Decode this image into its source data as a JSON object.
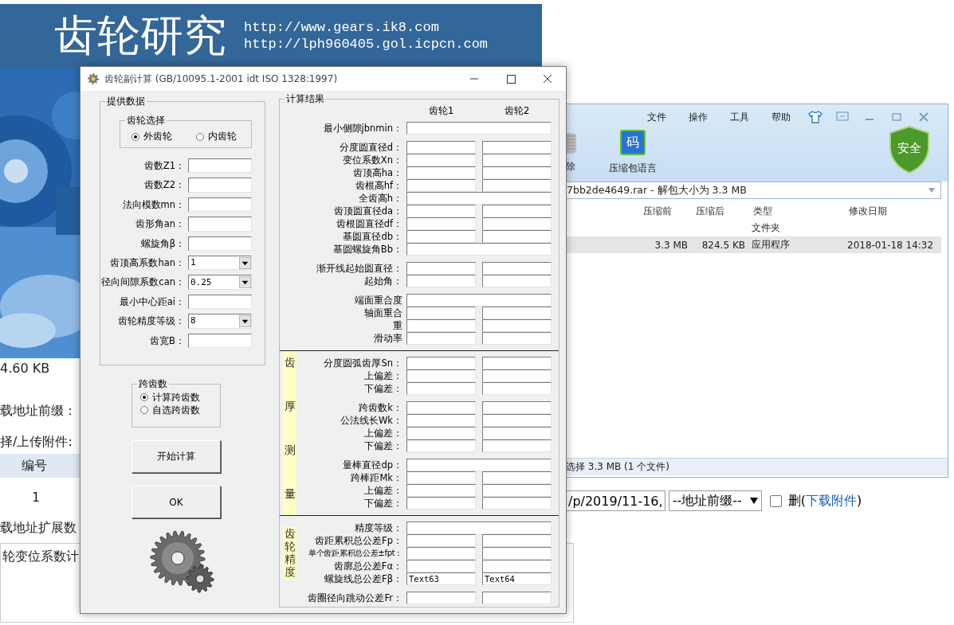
{
  "browser_page": {
    "banner": {
      "title": "齿轮研究",
      "urls": [
        "http://www.gears.ik8.com",
        "http://lph960405.gol.icpcn.com"
      ]
    },
    "file_size": "4.60 KB",
    "labels": [
      "载地址前缀：",
      "择/上传附件:"
    ],
    "table": {
      "header": "编号",
      "cell": "1"
    },
    "label_extra": "载地址扩展数",
    "box_text": "轮变位系数计",
    "path_field": {
      "value": "/p/2019/11-16,"
    },
    "prefix_select": {
      "value": "--地址前缀--"
    },
    "delete_option": {
      "checked": false,
      "before": "删(",
      "link": "下载附件",
      "after": ")"
    }
  },
  "archiver": {
    "menu": [
      "文件",
      "操作",
      "工具",
      "帮助"
    ],
    "tools": [
      {
        "kind": "trash",
        "label": "除"
      },
      {
        "kind": "code",
        "label": "压缩包语言",
        "icon_text": "码"
      }
    ],
    "badge": "安全",
    "path": "7bb2de4649.rar - 解包大小为 3.3 MB",
    "columns": [
      "压缩前",
      "压缩后",
      "类型",
      "修改日期"
    ],
    "rows": [
      {
        "type": "文件夹",
        "selected": false
      },
      {
        "before": "3.3 MB",
        "after": "824.5 KB",
        "type": "应用程序",
        "date": "2018-01-18 14:32",
        "selected": true
      }
    ],
    "status": "选择 3.3 MB (1 个文件)"
  },
  "dialog": {
    "title": "齿轮副计算 (GB/10095.1-2001 idt ISO 1328:1997)",
    "input_group": {
      "title": "提供数据",
      "gear_type": {
        "title": "齿轮选择",
        "options": [
          {
            "label": "外齿轮",
            "selected": true
          },
          {
            "label": "内齿轮",
            "selected": false
          }
        ]
      },
      "fields": [
        {
          "label": "齿数Z1：",
          "kind": "text"
        },
        {
          "label": "齿数Z2：",
          "kind": "text"
        },
        {
          "label": "法向模数mn：",
          "kind": "text"
        },
        {
          "label": "齿形角an：",
          "kind": "text"
        },
        {
          "label": "螺旋角β：",
          "kind": "text"
        },
        {
          "label": "齿顶高系数han：",
          "kind": "select",
          "value": "1"
        },
        {
          "label": "径向间隙系数can：",
          "kind": "select",
          "value": "0.25"
        },
        {
          "label": "最小中心距ai：",
          "kind": "text"
        },
        {
          "label": "齿轮精度等级：",
          "kind": "select",
          "value": "8"
        },
        {
          "label": "齿宽B：",
          "kind": "text"
        }
      ]
    },
    "span_group": {
      "title": "跨齿数",
      "options": [
        {
          "label": "计算跨齿数",
          "selected": true
        },
        {
          "label": "自选跨齿数",
          "selected": false
        }
      ]
    },
    "buttons": [
      "开始计算",
      "OK"
    ],
    "results": {
      "title": "计算结果",
      "headers": [
        "齿轮1",
        "齿轮2"
      ],
      "sections": [
        {
          "kind": "plain",
          "groups": [
            [
              {
                "label": "最小侧隙jbnmin：",
                "kind": "single"
              }
            ],
            [
              {
                "label": "分度圆直径d：",
                "kind": "pair"
              },
              {
                "label": "变位系数Xn：",
                "kind": "pair"
              },
              {
                "label": "齿顶高ha：",
                "kind": "pair"
              },
              {
                "label": "齿根高hf：",
                "kind": "pair"
              },
              {
                "label": "全齿高h：",
                "kind": "single"
              },
              {
                "label": "齿顶圆直径da：",
                "kind": "pair"
              },
              {
                "label": "齿根圆直径df：",
                "kind": "pair"
              },
              {
                "label": "基圆直径db：",
                "kind": "pair"
              },
              {
                "label": "基圆螺旋角Bb：",
                "kind": "single"
              }
            ],
            [
              {
                "label": "渐开线起始圆直径：",
                "kind": "pair"
              },
              {
                "label": "起始角：",
                "kind": "pair"
              }
            ],
            [
              {
                "label": "端面重合度",
                "kind": "single"
              },
              {
                "label": "轴面重合",
                "kind": "pair"
              },
              {
                "label": "重",
                "kind": "pair"
              },
              {
                "label": "滑动率",
                "kind": "pair"
              }
            ]
          ]
        },
        {
          "kind": "spread",
          "label": "齿厚测量",
          "groups": [
            [
              {
                "label": "分度圆弧齿厚Sn：",
                "kind": "pair"
              },
              {
                "label": "上偏差：",
                "kind": "pair"
              },
              {
                "label": "下偏差：",
                "kind": "pair"
              }
            ],
            [
              {
                "label": "跨齿数k：",
                "kind": "pair"
              },
              {
                "label": "公法线长Wk：",
                "kind": "pair"
              },
              {
                "label": "上偏差：",
                "kind": "pair"
              },
              {
                "label": "下偏差：",
                "kind": "pair"
              }
            ],
            [
              {
                "label": "量棒直径dp：",
                "kind": "single"
              },
              {
                "label": "跨棒距Mk：",
                "kind": "pair"
              },
              {
                "label": "上偏差：",
                "kind": "pair"
              },
              {
                "label": "下偏差：",
                "kind": "pair"
              }
            ]
          ]
        },
        {
          "kind": "compact",
          "label": "齿轮精度",
          "groups": [
            [
              {
                "label": "精度等级：",
                "kind": "single"
              },
              {
                "label": "齿距累积总公差Fp：",
                "kind": "pair"
              },
              {
                "label": "单个齿距累积总公差±fpt：",
                "kind": "pair",
                "small": true
              },
              {
                "label": "齿廓总公差Fα：",
                "kind": "pair"
              },
              {
                "label": "螺旋线总公差Fβ：",
                "kind": "pair",
                "values": [
                  "Text63",
                  "Text64"
                ]
              }
            ],
            [
              {
                "label": "齿圈径向跳动公差Fr：",
                "kind": "pair"
              }
            ]
          ]
        }
      ]
    }
  }
}
